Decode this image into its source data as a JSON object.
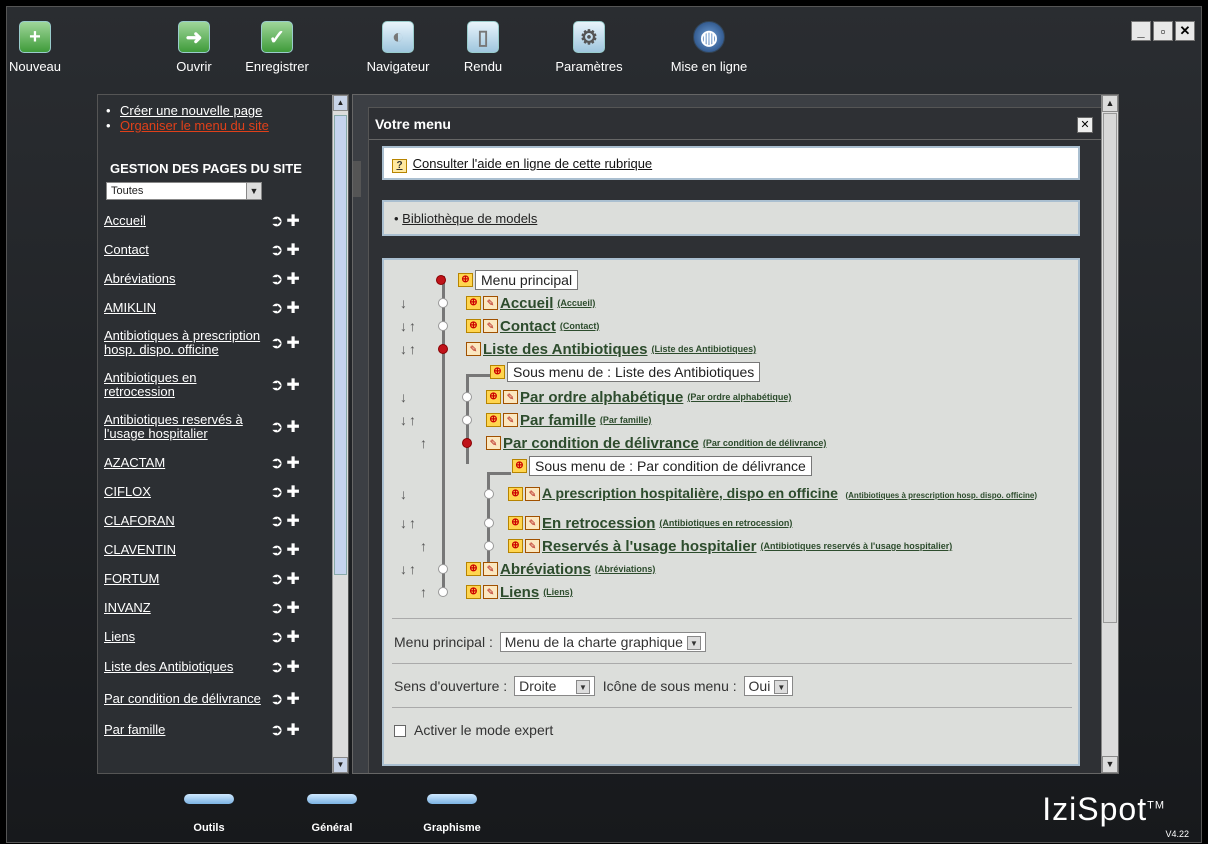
{
  "toolbar": {
    "items": [
      {
        "label": "Nouveau"
      },
      {
        "label": "Ouvrir"
      },
      {
        "label": "Enregistrer"
      },
      {
        "label": "Navigateur"
      },
      {
        "label": "Rendu"
      },
      {
        "label": "Paramètres"
      },
      {
        "label": "Mise en ligne"
      }
    ]
  },
  "sidebar": {
    "links": [
      "Créer une nouvelle page",
      "Organiser le menu du site"
    ],
    "heading": "GESTION DES PAGES DU SITE",
    "filter": "Toutes",
    "pages": [
      "Accueil",
      "Contact",
      "Abréviations",
      "AMIKLIN",
      "Antibiotiques à prescription hosp. dispo. officine",
      "Antibiotiques en retrocession",
      "Antibiotiques reservés à l'usage hospitalier",
      "AZACTAM",
      "CIFLOX",
      "CLAFORAN",
      "CLAVENTIN",
      "FORTUM",
      "INVANZ",
      "Liens",
      "Liste des Antibiotiques",
      "Par condition de délivrance",
      "Par famille"
    ]
  },
  "panel": {
    "title": "Votre menu",
    "help_link": "Consulter l'aide en ligne de cette rubrique",
    "library_link": "Bibliothèque de models",
    "tree": {
      "root": "Menu principal",
      "accueil": {
        "name": "Accueil",
        "sub": "(Accueil)"
      },
      "contact": {
        "name": "Contact",
        "sub": "(Contact)"
      },
      "liste": {
        "name": "Liste des Antibiotiques",
        "sub": "(Liste des Antibiotiques)"
      },
      "sous_liste": "Sous menu de : Liste des Antibiotiques",
      "alpha": {
        "name": "Par ordre alphabétique",
        "sub": "(Par ordre alphabétique)"
      },
      "famille": {
        "name": "Par famille",
        "sub": "(Par famille)"
      },
      "condition": {
        "name": "Par condition de délivrance",
        "sub": "(Par condition de délivrance)"
      },
      "sous_condition": "Sous menu de : Par condition de délivrance",
      "prescription": {
        "name": "A prescription hospitalière, dispo en officine",
        "sub": "(Antibiotiques à prescription hosp. dispo. officine)"
      },
      "retrocession": {
        "name": "En retrocession",
        "sub": "(Antibiotiques en retrocession)"
      },
      "reserves": {
        "name": "Reservés à l'usage hospitalier",
        "sub": "(Antibiotiques reservés à l'usage hospitalier)"
      },
      "abreviations": {
        "name": "Abréviations",
        "sub": "(Abréviations)"
      },
      "liens": {
        "name": "Liens",
        "sub": "(Liens)"
      }
    },
    "options": {
      "menu_principal_label": "Menu principal :",
      "menu_principal_value": "Menu de la charte graphique",
      "sens_label": "Sens d'ouverture :",
      "sens_value": "Droite",
      "icone_label": "Icône de sous menu :",
      "icone_value": "Oui",
      "expert_label": "Activer le mode expert"
    }
  },
  "bottom": {
    "tabs": [
      "Outils",
      "Général",
      "Graphisme"
    ],
    "brand": "IziSpot",
    "tm": "TM",
    "version": "V4.22"
  },
  "colors": {
    "accent_link_red": "#e0401a",
    "tree_text": "#2d4c2d"
  }
}
